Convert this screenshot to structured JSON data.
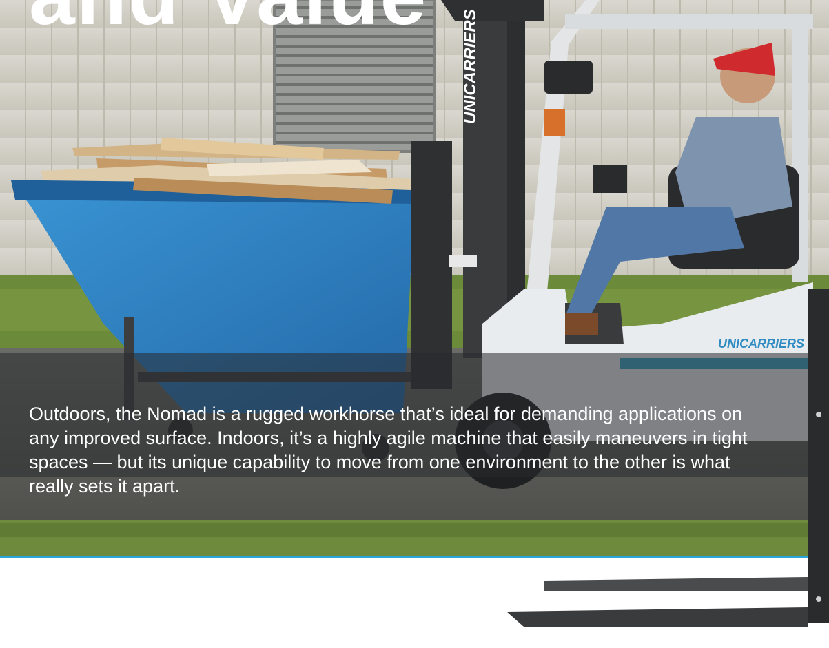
{
  "headline": "and Value",
  "caption": "Outdoors, the Nomad is a rugged workhorse that’s ideal for demanding applications on any improved surface. Indoors, it’s a highly agile machine that easily maneuvers in tight spaces — but its unique capability to move from one environment to the other is what really sets it apart.",
  "photo": {
    "brand_mast": "UNICARRIERS",
    "brand_body": "UNICARRIERS"
  },
  "colors": {
    "accent_rule": "#2aa6d8",
    "dumpster_blue": "#2f86c8",
    "truck_white": "#e9ecef"
  }
}
